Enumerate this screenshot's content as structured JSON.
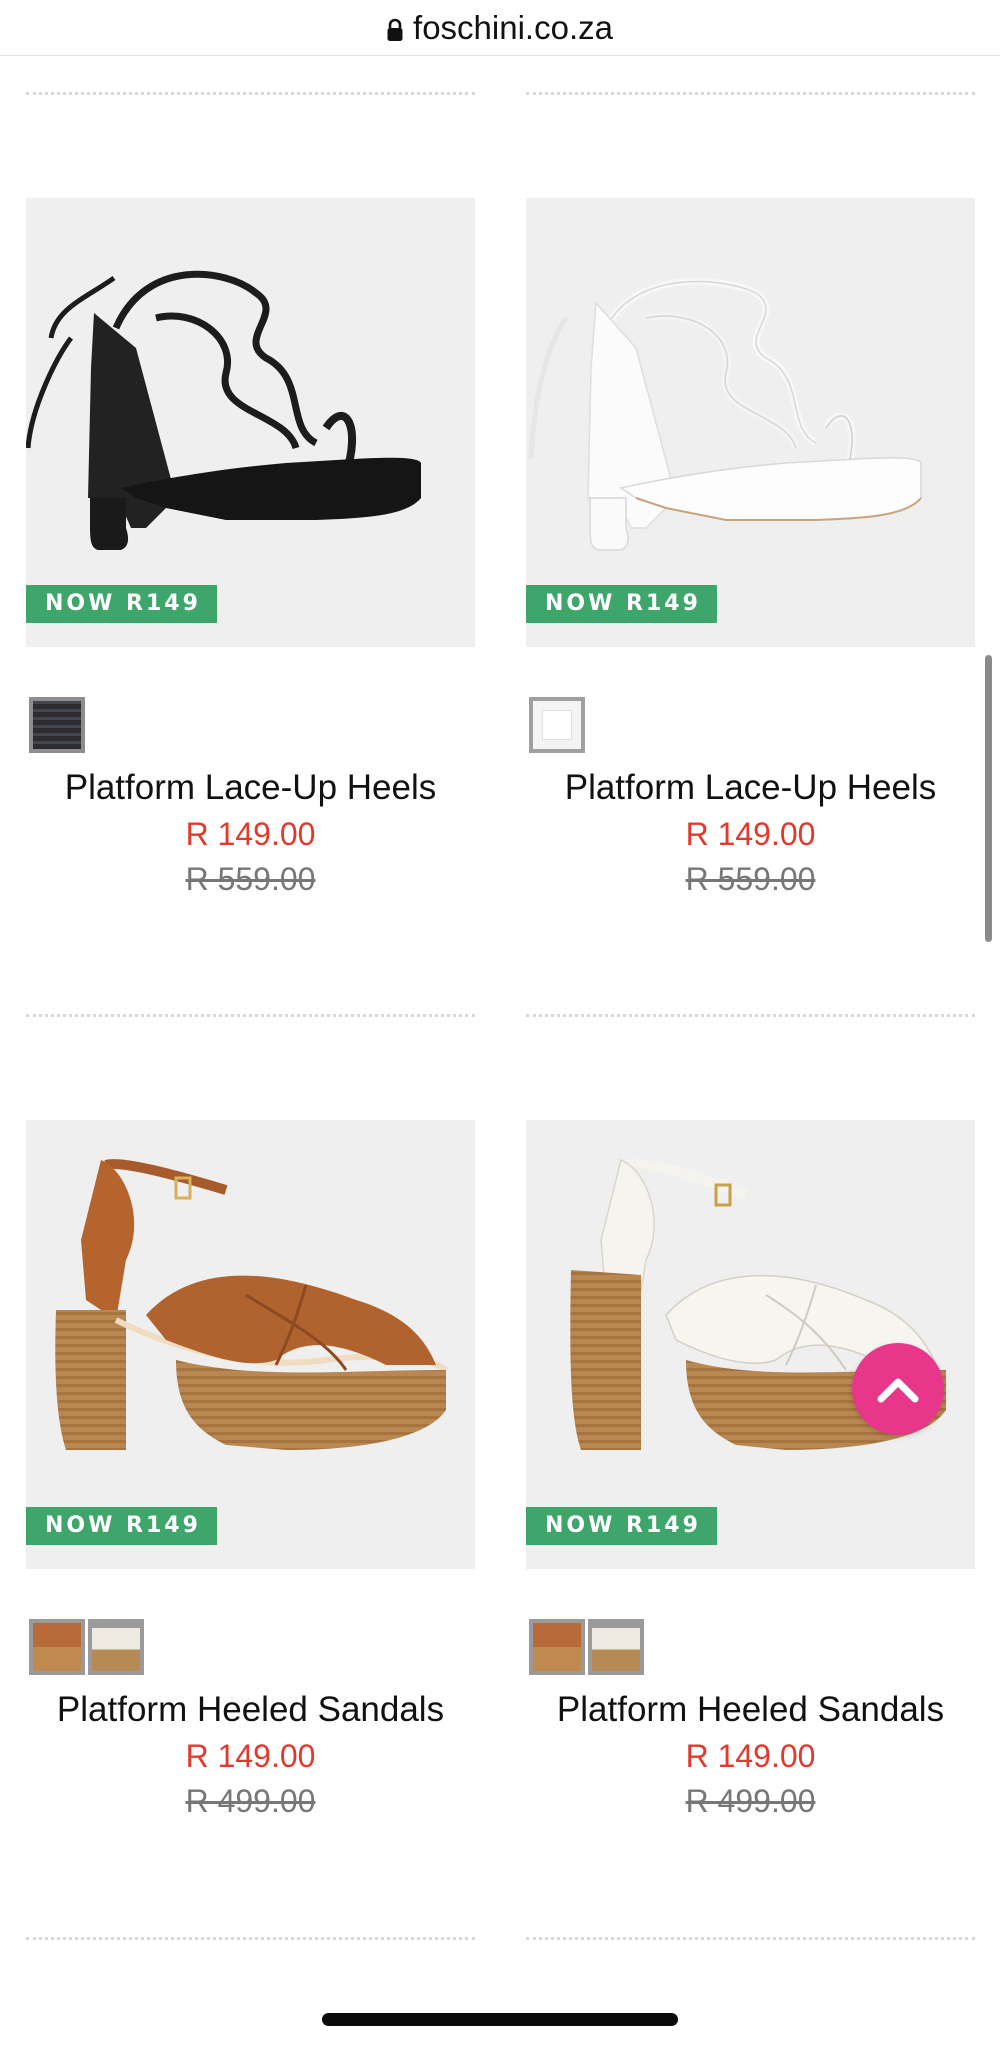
{
  "browser": {
    "url": "foschini.co.za"
  },
  "products": [
    {
      "name": "Platform Lace-Up Heels",
      "badge": "NOW R149",
      "price_now": "R 149.00",
      "price_was": "R 559.00",
      "color": "black",
      "swatches": [
        "black"
      ]
    },
    {
      "name": "Platform Lace-Up Heels",
      "badge": "NOW R149",
      "price_now": "R 149.00",
      "price_was": "R 559.00",
      "color": "white",
      "swatches": [
        "white"
      ]
    },
    {
      "name": "Platform Heeled Sandals",
      "badge": "NOW R149",
      "price_now": "R 149.00",
      "price_was": "R 499.00",
      "color": "tan",
      "swatches": [
        "tan",
        "cream"
      ]
    },
    {
      "name": "Platform Heeled Sandals",
      "badge": "NOW R149",
      "price_now": "R 149.00",
      "price_was": "R 499.00",
      "color": "white",
      "swatches": [
        "tan",
        "cream"
      ]
    }
  ],
  "icons": {
    "lock": "lock-icon",
    "back_to_top": "chevron-up-icon"
  },
  "colors": {
    "sale_badge": "#3ea66b",
    "price_now": "#e03a2f",
    "price_was": "#777777",
    "back_to_top": "#e8368a"
  }
}
